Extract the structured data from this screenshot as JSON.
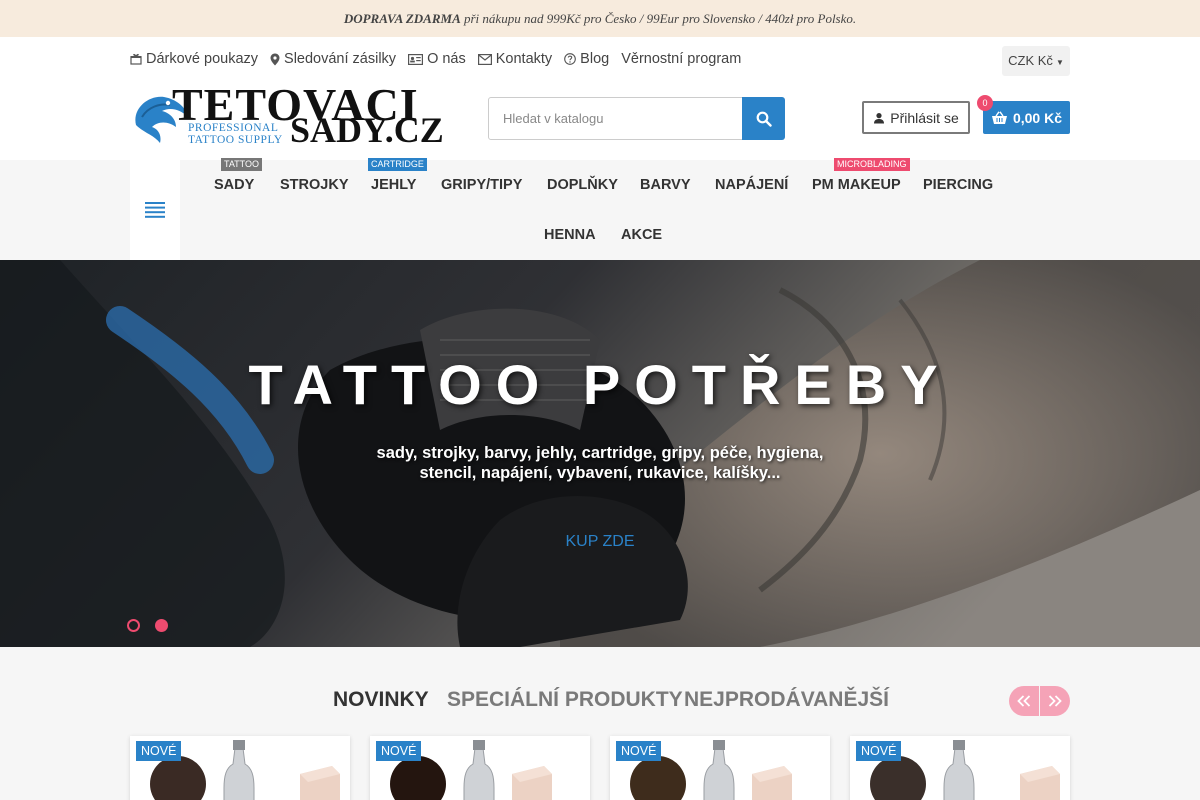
{
  "promo": {
    "bold": "DOPRAVA ZDARMA",
    "text": " při nákupu nad 999Kč pro Česko / 99Eur pro Slovensko / 440zł pro Polsko."
  },
  "top_links": [
    {
      "icon": "gift-card-icon",
      "label": "Dárkové poukazy"
    },
    {
      "icon": "location-pin-icon",
      "label": "Sledování zásilky"
    },
    {
      "icon": "id-card-icon",
      "label": "O nás"
    },
    {
      "icon": "envelope-icon",
      "label": "Kontakty"
    },
    {
      "icon": "question-icon",
      "label": "Blog"
    },
    {
      "icon": "",
      "label": "Věrnostní program"
    }
  ],
  "currency": "CZK Kč",
  "logo": {
    "line1": "TETOVACI",
    "line2": "SADY.CZ",
    "tagline1": "PROFESSIONAL",
    "tagline2": "TATTOO SUPPLY"
  },
  "search": {
    "placeholder": "Hledat v katalogu"
  },
  "login_label": "Přihlásit se",
  "cart": {
    "count": "0",
    "total": "0,00 Kč"
  },
  "nav": [
    {
      "label": "SADY",
      "badge": "TATTOO"
    },
    {
      "label": "STROJKY"
    },
    {
      "label": "JEHLY",
      "badge": "CARTRIDGE"
    },
    {
      "label": "GRIPY/TIPY"
    },
    {
      "label": "DOPLŇKY"
    },
    {
      "label": "BARVY"
    },
    {
      "label": "NAPÁJENÍ"
    },
    {
      "label": "PM MAKEUP",
      "badge": "MICROBLADING"
    },
    {
      "label": "PIERCING"
    },
    {
      "label": "HENNA"
    },
    {
      "label": "AKCE"
    }
  ],
  "hero": {
    "title": "TATTOO POTŘEBY",
    "subtitle": "sady, strojky, barvy, jehly, cartridge, gripy, péče, hygiena, stencil, napájení, vybavení, rukavice, kalíšky...",
    "cta": "KUP ZDE"
  },
  "tabs": [
    "NOVINKY",
    "SPECIÁLNÍ PRODUKTY",
    "NEJPRODÁVANĚJŠÍ"
  ],
  "products": [
    {
      "flag": "NOVÉ",
      "ink": "#3a2a24"
    },
    {
      "flag": "NOVÉ",
      "ink": "#24150f"
    },
    {
      "flag": "NOVÉ",
      "ink": "#3e2c1c"
    },
    {
      "flag": "NOVÉ",
      "ink": "#3a2f2a"
    }
  ],
  "colors": {
    "accent": "#2a82c8",
    "pink": "#ee4b6f",
    "promo_bg": "#f7ebdd"
  }
}
